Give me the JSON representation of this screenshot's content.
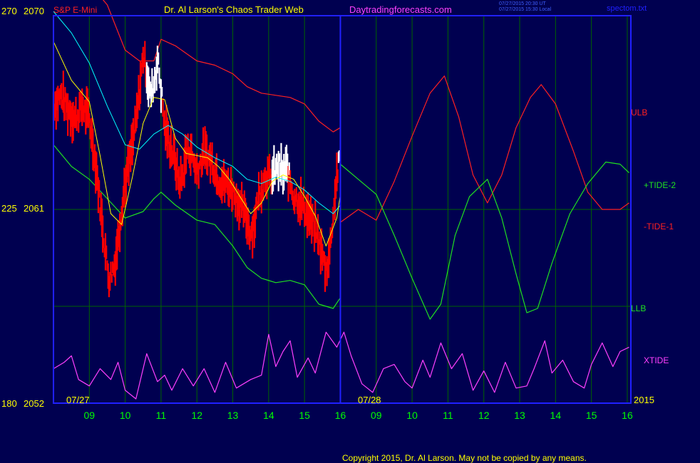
{
  "header": {
    "instrument": "S&P E-Mini",
    "site_title": "Dr. Al Larson's Chaos Trader Web",
    "website": "Daytradingforecasts.com",
    "update_line_1": "07/27/2015 20:30 UT",
    "update_line_2": "07/27/2015 15:30 Local",
    "file_name": "spectom.txt"
  },
  "footer": {
    "copyright": "Copyright 2015, Dr. Al Larson. May not be copied by any means."
  },
  "colors": {
    "background": "#000050",
    "plot_border": "#2020ff",
    "grid": "#006400",
    "price_bar": "#ff0000",
    "price_bar_high": "#ffffff",
    "ma_fast": "#ffff00",
    "ma_slow": "#00ffff",
    "ulb": "#ff2020",
    "llb": "#20e020",
    "tide_plus": "#20e020",
    "tide_minus": "#ff2020",
    "xtide": "#ff40ff",
    "axis_text": "#00ff00",
    "left_axis_text": "#ffff00"
  },
  "chart_data": {
    "type": "line",
    "y_left_labels": [
      {
        "osc": "270",
        "price": "2070"
      },
      {
        "osc": "225",
        "price": "2061"
      },
      {
        "osc": "180",
        "price": "2052"
      }
    ],
    "ylim": [
      2052,
      2070
    ],
    "date_labels": [
      "07/27",
      "07/28"
    ],
    "year_label": "2015",
    "x_ticks": [
      "09",
      "10",
      "11",
      "12",
      "13",
      "14",
      "15",
      "16",
      "09",
      "10",
      "11",
      "12",
      "13",
      "14",
      "15",
      "16"
    ],
    "xlim": [
      8,
      24.1
    ],
    "now_hour": 16,
    "series_labels": {
      "ulb": "ULB",
      "tide2": "+TIDE-2",
      "tide1": "-TIDE-1",
      "llb": "LLB",
      "xtide": "XTIDE"
    },
    "price_close": [
      [
        8.0,
        2065.8
      ],
      [
        8.2,
        2066.3
      ],
      [
        8.4,
        2065.7
      ],
      [
        8.6,
        2065.2
      ],
      [
        8.8,
        2065.8
      ],
      [
        9.0,
        2065.2
      ],
      [
        9.2,
        2062.8
      ],
      [
        9.3,
        2061.2
      ],
      [
        9.45,
        2059.0
      ],
      [
        9.55,
        2057.8
      ],
      [
        9.7,
        2058.4
      ],
      [
        9.8,
        2059.6
      ],
      [
        9.9,
        2061.0
      ],
      [
        10.0,
        2062.3
      ],
      [
        10.15,
        2063.5
      ],
      [
        10.3,
        2065.0
      ],
      [
        10.4,
        2066.5
      ],
      [
        10.5,
        2068.2
      ],
      [
        10.6,
        2067.4
      ],
      [
        10.7,
        2066.3
      ],
      [
        10.8,
        2066.8
      ],
      [
        10.9,
        2068.0
      ],
      [
        11.0,
        2066.6
      ],
      [
        11.1,
        2064.8
      ],
      [
        11.2,
        2064.3
      ],
      [
        11.3,
        2063.7
      ],
      [
        11.4,
        2063.2
      ],
      [
        11.5,
        2062.3
      ],
      [
        11.6,
        2062.5
      ],
      [
        11.7,
        2063.6
      ],
      [
        11.8,
        2063.8
      ],
      [
        12.0,
        2062.8
      ],
      [
        12.2,
        2063.6
      ],
      [
        12.4,
        2063.3
      ],
      [
        12.6,
        2062.4
      ],
      [
        12.8,
        2062.2
      ],
      [
        13.0,
        2061.9
      ],
      [
        13.2,
        2061.2
      ],
      [
        13.4,
        2060.5
      ],
      [
        13.5,
        2059.9
      ],
      [
        13.6,
        2060.4
      ],
      [
        13.7,
        2061.5
      ],
      [
        13.8,
        2062.0
      ],
      [
        13.9,
        2062.6
      ],
      [
        14.0,
        2062.5
      ],
      [
        14.1,
        2062.5
      ],
      [
        14.2,
        2062.8
      ],
      [
        14.3,
        2063.0
      ],
      [
        14.4,
        2062.6
      ],
      [
        14.5,
        2062.9
      ],
      [
        14.6,
        2062.3
      ],
      [
        14.7,
        2061.6
      ],
      [
        14.8,
        2061.5
      ],
      [
        15.0,
        2061.0
      ],
      [
        15.2,
        2060.4
      ],
      [
        15.4,
        2059.6
      ],
      [
        15.5,
        2058.8
      ],
      [
        15.6,
        2058.2
      ],
      [
        15.7,
        2059.0
      ],
      [
        15.8,
        2060.8
      ],
      [
        15.9,
        2062.6
      ],
      [
        16.0,
        2063.4
      ]
    ],
    "ulb": [
      [
        8.0,
        2072.5
      ],
      [
        9.0,
        2071.5
      ],
      [
        9.5,
        2070.5
      ],
      [
        10.0,
        2068.4
      ],
      [
        10.4,
        2067.9
      ],
      [
        10.8,
        2067.9
      ],
      [
        11.0,
        2068.9
      ],
      [
        11.4,
        2068.6
      ],
      [
        12.0,
        2067.9
      ],
      [
        12.5,
        2067.7
      ],
      [
        13.0,
        2067.3
      ],
      [
        13.4,
        2066.7
      ],
      [
        13.8,
        2066.4
      ],
      [
        14.2,
        2066.3
      ],
      [
        14.6,
        2066.2
      ],
      [
        15.0,
        2065.9
      ],
      [
        15.4,
        2065.1
      ],
      [
        15.8,
        2064.6
      ],
      [
        16.0,
        2064.8
      ]
    ],
    "llb": [
      [
        8.0,
        2064.0
      ],
      [
        8.5,
        2063.0
      ],
      [
        9.0,
        2062.4
      ],
      [
        9.5,
        2061.5
      ],
      [
        10.0,
        2060.6
      ],
      [
        10.5,
        2060.9
      ],
      [
        10.8,
        2061.5
      ],
      [
        11.0,
        2061.8
      ],
      [
        11.4,
        2061.2
      ],
      [
        12.0,
        2060.5
      ],
      [
        12.5,
        2060.3
      ],
      [
        13.0,
        2059.3
      ],
      [
        13.4,
        2058.3
      ],
      [
        13.8,
        2057.8
      ],
      [
        14.2,
        2057.6
      ],
      [
        14.6,
        2057.7
      ],
      [
        15.0,
        2057.5
      ],
      [
        15.4,
        2056.6
      ],
      [
        15.8,
        2056.4
      ],
      [
        16.0,
        2056.9
      ]
    ],
    "ma_fast": [
      [
        8.0,
        2068.8
      ],
      [
        8.5,
        2067.0
      ],
      [
        9.0,
        2066.0
      ],
      [
        9.3,
        2063.5
      ],
      [
        9.6,
        2060.8
      ],
      [
        9.9,
        2060.3
      ],
      [
        10.2,
        2062.5
      ],
      [
        10.5,
        2065.0
      ],
      [
        10.8,
        2066.2
      ],
      [
        11.1,
        2066.1
      ],
      [
        11.4,
        2064.3
      ],
      [
        11.7,
        2063.6
      ],
      [
        12.0,
        2063.5
      ],
      [
        12.3,
        2063.4
      ],
      [
        12.6,
        2063.0
      ],
      [
        12.9,
        2062.4
      ],
      [
        13.2,
        2061.6
      ],
      [
        13.5,
        2060.8
      ],
      [
        13.8,
        2061.3
      ],
      [
        14.1,
        2062.3
      ],
      [
        14.4,
        2062.6
      ],
      [
        14.7,
        2062.4
      ],
      [
        15.0,
        2061.6
      ],
      [
        15.3,
        2060.7
      ],
      [
        15.6,
        2059.3
      ],
      [
        15.9,
        2060.6
      ],
      [
        16.0,
        2061.7
      ]
    ],
    "ma_slow": [
      [
        8.0,
        2070.2
      ],
      [
        8.5,
        2069.2
      ],
      [
        9.0,
        2067.8
      ],
      [
        9.5,
        2065.8
      ],
      [
        10.0,
        2064.0
      ],
      [
        10.4,
        2063.8
      ],
      [
        10.8,
        2064.5
      ],
      [
        11.2,
        2064.9
      ],
      [
        11.6,
        2064.5
      ],
      [
        12.0,
        2063.9
      ],
      [
        12.5,
        2063.4
      ],
      [
        13.0,
        2063.0
      ],
      [
        13.4,
        2062.4
      ],
      [
        13.8,
        2062.2
      ],
      [
        14.2,
        2062.5
      ],
      [
        14.6,
        2062.3
      ],
      [
        15.0,
        2061.9
      ],
      [
        15.4,
        2061.3
      ],
      [
        15.8,
        2060.8
      ],
      [
        16.0,
        2061.2
      ]
    ],
    "tide_plus": [
      [
        16.0,
        2063.1
      ],
      [
        16.5,
        2062.4
      ],
      [
        17.0,
        2061.7
      ],
      [
        17.5,
        2059.8
      ],
      [
        18.0,
        2057.8
      ],
      [
        18.5,
        2055.9
      ],
      [
        18.8,
        2056.6
      ],
      [
        19.2,
        2059.8
      ],
      [
        19.6,
        2061.6
      ],
      [
        20.1,
        2062.4
      ],
      [
        20.5,
        2060.6
      ],
      [
        20.9,
        2058.0
      ],
      [
        21.2,
        2056.2
      ],
      [
        21.5,
        2056.4
      ],
      [
        21.9,
        2058.5
      ],
      [
        22.4,
        2060.8
      ],
      [
        22.9,
        2062.2
      ],
      [
        23.4,
        2063.2
      ],
      [
        23.8,
        2063.1
      ],
      [
        24.05,
        2062.7
      ]
    ],
    "tide_minus": [
      [
        16.0,
        2060.4
      ],
      [
        16.5,
        2061.0
      ],
      [
        17.0,
        2060.5
      ],
      [
        17.5,
        2062.3
      ],
      [
        18.0,
        2064.4
      ],
      [
        18.5,
        2066.4
      ],
      [
        18.9,
        2067.2
      ],
      [
        19.3,
        2065.3
      ],
      [
        19.7,
        2062.6
      ],
      [
        20.1,
        2061.3
      ],
      [
        20.5,
        2062.6
      ],
      [
        20.9,
        2064.8
      ],
      [
        21.3,
        2066.2
      ],
      [
        21.6,
        2066.8
      ],
      [
        22.0,
        2065.9
      ],
      [
        22.5,
        2063.7
      ],
      [
        22.9,
        2061.8
      ],
      [
        23.3,
        2061.0
      ],
      [
        23.8,
        2061.0
      ],
      [
        24.05,
        2061.3
      ]
    ],
    "xtide": [
      [
        8.0,
        2053.6
      ],
      [
        8.3,
        2053.9
      ],
      [
        8.5,
        2054.2
      ],
      [
        8.7,
        2053.1
      ],
      [
        9.0,
        2052.8
      ],
      [
        9.3,
        2053.6
      ],
      [
        9.6,
        2053.1
      ],
      [
        9.8,
        2053.9
      ],
      [
        10.0,
        2052.6
      ],
      [
        10.3,
        2052.2
      ],
      [
        10.6,
        2054.3
      ],
      [
        10.9,
        2053.0
      ],
      [
        11.1,
        2053.3
      ],
      [
        11.3,
        2052.6
      ],
      [
        11.6,
        2053.6
      ],
      [
        11.9,
        2052.8
      ],
      [
        12.2,
        2053.6
      ],
      [
        12.5,
        2052.5
      ],
      [
        12.8,
        2053.9
      ],
      [
        13.1,
        2052.7
      ],
      [
        13.5,
        2053.1
      ],
      [
        13.8,
        2053.3
      ],
      [
        14.0,
        2055.2
      ],
      [
        14.2,
        2053.7
      ],
      [
        14.4,
        2054.4
      ],
      [
        14.6,
        2054.9
      ],
      [
        14.8,
        2053.2
      ],
      [
        15.1,
        2054.1
      ],
      [
        15.3,
        2053.4
      ],
      [
        15.6,
        2055.3
      ],
      [
        15.9,
        2054.6
      ],
      [
        16.1,
        2055.3
      ],
      [
        16.3,
        2054.2
      ],
      [
        16.6,
        2052.9
      ],
      [
        16.9,
        2052.5
      ],
      [
        17.2,
        2053.6
      ],
      [
        17.5,
        2053.8
      ],
      [
        17.8,
        2053.0
      ],
      [
        18.0,
        2052.7
      ],
      [
        18.3,
        2054.0
      ],
      [
        18.5,
        2053.2
      ],
      [
        18.8,
        2054.8
      ],
      [
        19.1,
        2053.6
      ],
      [
        19.4,
        2054.3
      ],
      [
        19.7,
        2052.6
      ],
      [
        20.0,
        2053.5
      ],
      [
        20.3,
        2052.5
      ],
      [
        20.6,
        2053.9
      ],
      [
        20.9,
        2052.7
      ],
      [
        21.2,
        2052.8
      ],
      [
        21.4,
        2053.6
      ],
      [
        21.7,
        2054.9
      ],
      [
        21.9,
        2053.4
      ],
      [
        22.2,
        2054.0
      ],
      [
        22.5,
        2053.0
      ],
      [
        22.8,
        2052.7
      ],
      [
        23.0,
        2053.8
      ],
      [
        23.3,
        2054.8
      ],
      [
        23.6,
        2053.7
      ],
      [
        23.8,
        2054.4
      ],
      [
        24.05,
        2054.6
      ]
    ]
  }
}
